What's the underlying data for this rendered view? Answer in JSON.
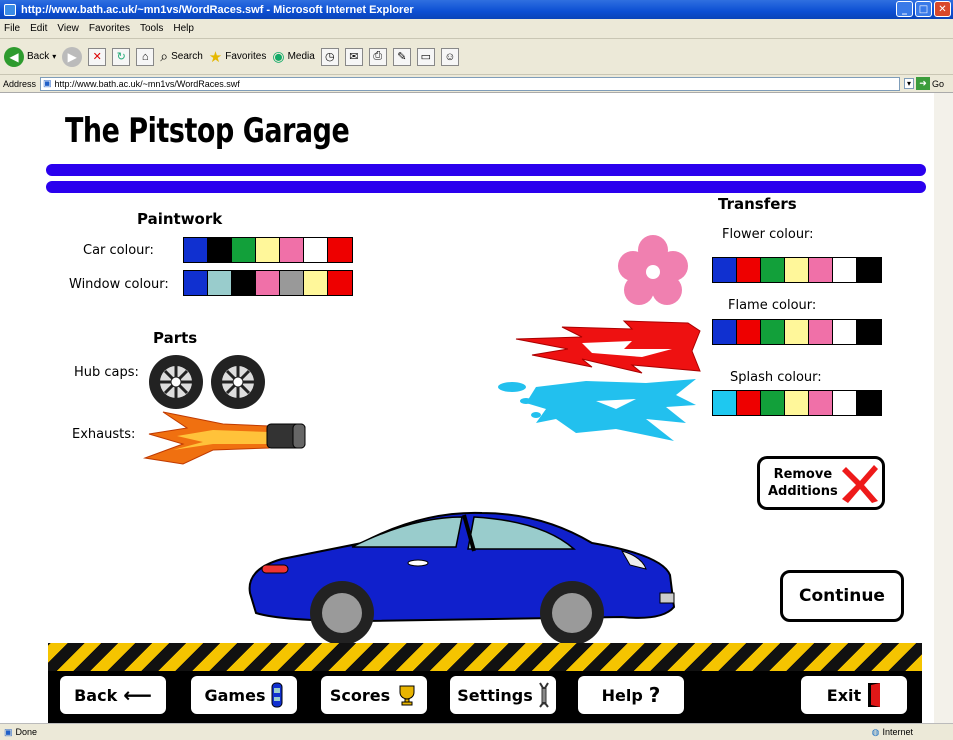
{
  "browser": {
    "title": "http://www.bath.ac.uk/~mn1vs/WordRaces.swf - Microsoft Internet Explorer",
    "menu": [
      "File",
      "Edit",
      "View",
      "Favorites",
      "Tools",
      "Help"
    ],
    "toolbar": {
      "back": "Back",
      "search": "Search",
      "favorites": "Favorites",
      "media": "Media"
    },
    "address_label": "Address",
    "address": "http://www.bath.ac.uk/~mn1vs/WordRaces.swf",
    "go": "Go",
    "status": "Done",
    "zone": "Internet"
  },
  "page": {
    "title": "The Pitstop Garage",
    "paintwork": {
      "heading": "Paintwork",
      "car_label": "Car colour:",
      "car_colours": [
        "#1030d0",
        "#000000",
        "#12a03a",
        "#fff79a",
        "#f070a8",
        "#ffffff",
        "#ee0000"
      ],
      "window_label": "Window colour:",
      "window_colours": [
        "#1030d0",
        "#99cccc",
        "#000000",
        "#f070a8",
        "#999999",
        "#fff79a",
        "#ee0000"
      ]
    },
    "parts": {
      "heading": "Parts",
      "hubcaps_label": "Hub caps:",
      "exhausts_label": "Exhausts:"
    },
    "transfers": {
      "heading": "Transfers",
      "flower_label": "Flower colour:",
      "flower_colours": [
        "#1030d0",
        "#ee0000",
        "#12a03a",
        "#fff79a",
        "#f070a8",
        "#ffffff",
        "#000000"
      ],
      "flame_label": "Flame colour:",
      "flame_colours": [
        "#1030d0",
        "#ee0000",
        "#12a03a",
        "#fff79a",
        "#f070a8",
        "#ffffff",
        "#000000"
      ],
      "splash_label": "Splash colour:",
      "splash_colours": [
        "#1ec8f0",
        "#ee0000",
        "#12a03a",
        "#fff79a",
        "#f070a8",
        "#ffffff",
        "#000000"
      ]
    },
    "remove_label_1": "Remove",
    "remove_label_2": "Additions",
    "continue_label": "Continue",
    "nav": {
      "back": "Back",
      "games": "Games",
      "scores": "Scores",
      "settings": "Settings",
      "help": "Help",
      "exit": "Exit"
    },
    "colors": {
      "accent_bar": "#2a00ee",
      "car": "#1020cc",
      "flower": "#f080b0",
      "flame": "#ee1111",
      "splash": "#22c0ee"
    }
  }
}
